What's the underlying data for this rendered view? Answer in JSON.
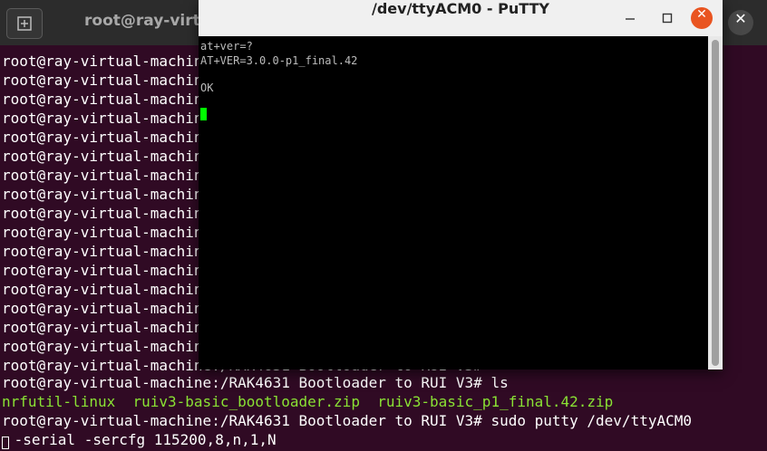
{
  "terminal": {
    "title": "root@ray-virtual",
    "prompt_lines": [
      "root@ray-virtual-machine:/RAK4631 Bootloader to RUI V3#",
      "root@ray-virtual-machine:/RAK4631 Bootloader to RUI V3#",
      "root@ray-virtual-machine:/RAK4631 Bootloader to RUI V3#",
      "root@ray-virtual-machine:/RAK4631 Bootloader to RUI V3#",
      "root@ray-virtual-machine:/RAK4631 Bootloader to RUI V3#",
      "root@ray-virtual-machine:/RAK4631 Bootloader to RUI V3#",
      "root@ray-virtual-machine:/RAK4631 Bootloader to RUI V3#",
      "root@ray-virtual-machine:/RAK4631 Bootloader to RUI V3#",
      "root@ray-virtual-machine:/RAK4631 Bootloader to RUI V3#",
      "root@ray-virtual-machine:/RAK4631 Bootloader to RUI V3#",
      "root@ray-virtual-machine:/RAK4631 Bootloader to RUI V3#",
      "root@ray-virtual-machine:/RAK4631 Bootloader to RUI V3#",
      "root@ray-virtual-machine:/RAK4631 Bootloader to RUI V3#",
      "root@ray-virtual-machine:/RAK4631 Bootloader to RUI V3#",
      "root@ray-virtual-machine:/RAK4631 Bootloader to RUI V3#",
      "root@ray-virtual-machine:/RAK4631 Bootloader to RUI V3#",
      "root@ray-virtual-machine:/RAK4631 Bootloader to RUI V3#"
    ],
    "ls_command": "root@ray-virtual-machine:/RAK4631 Bootloader to RUI V3# ls",
    "ls_output": "nrfutil-linux  ruiv3-basic_bootloader.zip  ruiv3-basic_p1_final.42.zip",
    "putty_command": "root@ray-virtual-machine:/RAK4631 Bootloader to RUI V3# sudo putty /dev/ttyACM0",
    "putty_command_cont": " -serial -sercfg 115200,8,n,1,N"
  },
  "putty": {
    "title": "/dev/ttyACM0 - PuTTY",
    "lines": {
      "cmd": "at+ver=?",
      "response": "AT+VER=3.0.0-p1_final.42",
      "ok": "OK"
    }
  },
  "colors": {
    "terminal_bg": "#300a24",
    "ls_output": "#8ae234",
    "putty_cursor": "#00ff00",
    "close_button": "#e95420"
  }
}
